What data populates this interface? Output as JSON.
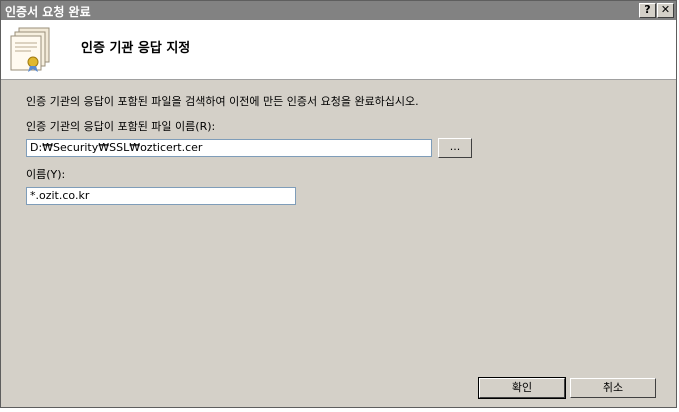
{
  "window": {
    "title": "인증서 요청 완료",
    "help_label": "?",
    "close_label": "✕"
  },
  "header": {
    "title": "인증 기관 응답 지정"
  },
  "body": {
    "description": "인증 기관의 응답이 포함된 파일을 검색하여 이전에 만든 인증서 요청을 완료하십시오.",
    "file_label": "인증 기관의 응답이 포함된 파일 이름(R):",
    "file_value": "D:₩Security₩SSL₩ozticert.cer",
    "browse_label": "...",
    "name_label": "이름(Y):",
    "name_value": "*.ozit.co.kr"
  },
  "footer": {
    "ok_label": "확인",
    "cancel_label": "취소"
  },
  "icons": {
    "header_icon": "certificate-icon"
  },
  "colors": {
    "titlebar": "#828282",
    "dialog_bg": "#d4d0c8",
    "header_bg": "#ffffff"
  }
}
